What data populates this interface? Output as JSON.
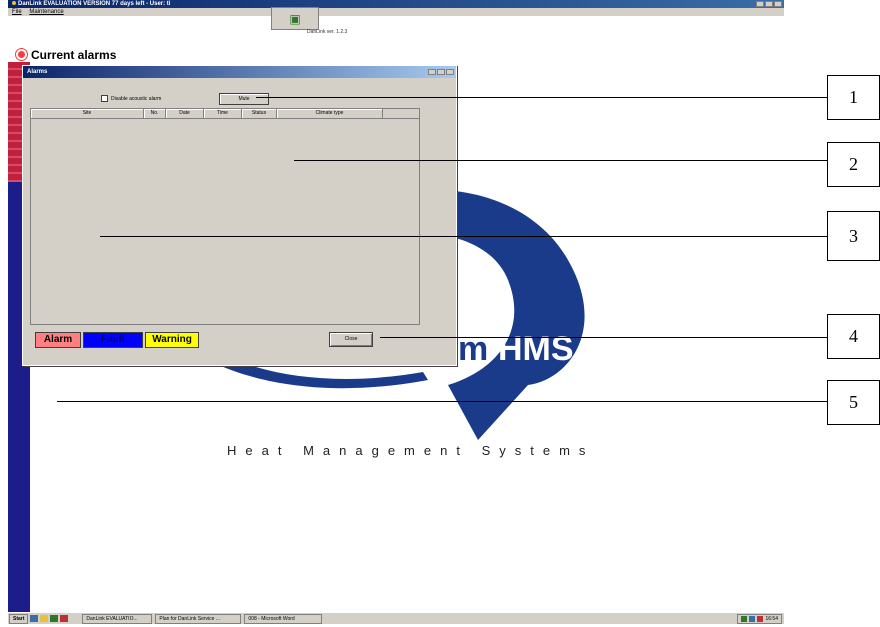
{
  "app": {
    "title": "DanLink EVALUATION VERSION   77 days left - User: ti",
    "menu": [
      "File",
      "Maintenance"
    ],
    "version": "DanLink ver. 1.2.3"
  },
  "main": {
    "heading": "Current alarms"
  },
  "alarms_window": {
    "title": "Alarms",
    "disable_acoustic_label": "Disable acoustic alarm",
    "mute_label": "Mute",
    "columns": [
      "Site",
      "No.",
      "Date",
      "Time",
      "Status",
      "Climate type"
    ],
    "legend": [
      {
        "label": "Alarm",
        "bg": "#ff8080"
      },
      {
        "label": "Fault",
        "bg": "#0000ff"
      },
      {
        "label": "Warning",
        "bg": "#ffff00"
      }
    ],
    "close_label": "Close"
  },
  "background": {
    "company_name": "Heat Management Systems",
    "logo_text": "HMS",
    "logo_fragment": "m"
  },
  "taskbar": {
    "start_label": "Start",
    "tasks": [
      "DanLink EVALUATIO...",
      "Plan for DanLink Service ...",
      "008 - Microsoft Word"
    ],
    "clock": "16:54"
  },
  "callouts": [
    "1",
    "2",
    "3",
    "4",
    "5"
  ],
  "colors": {
    "titlebar": "#0a246a",
    "window_bg": "#d4d0c8",
    "logo_blue": "#1a3a8a",
    "accent_red": "#ff3a3a"
  }
}
